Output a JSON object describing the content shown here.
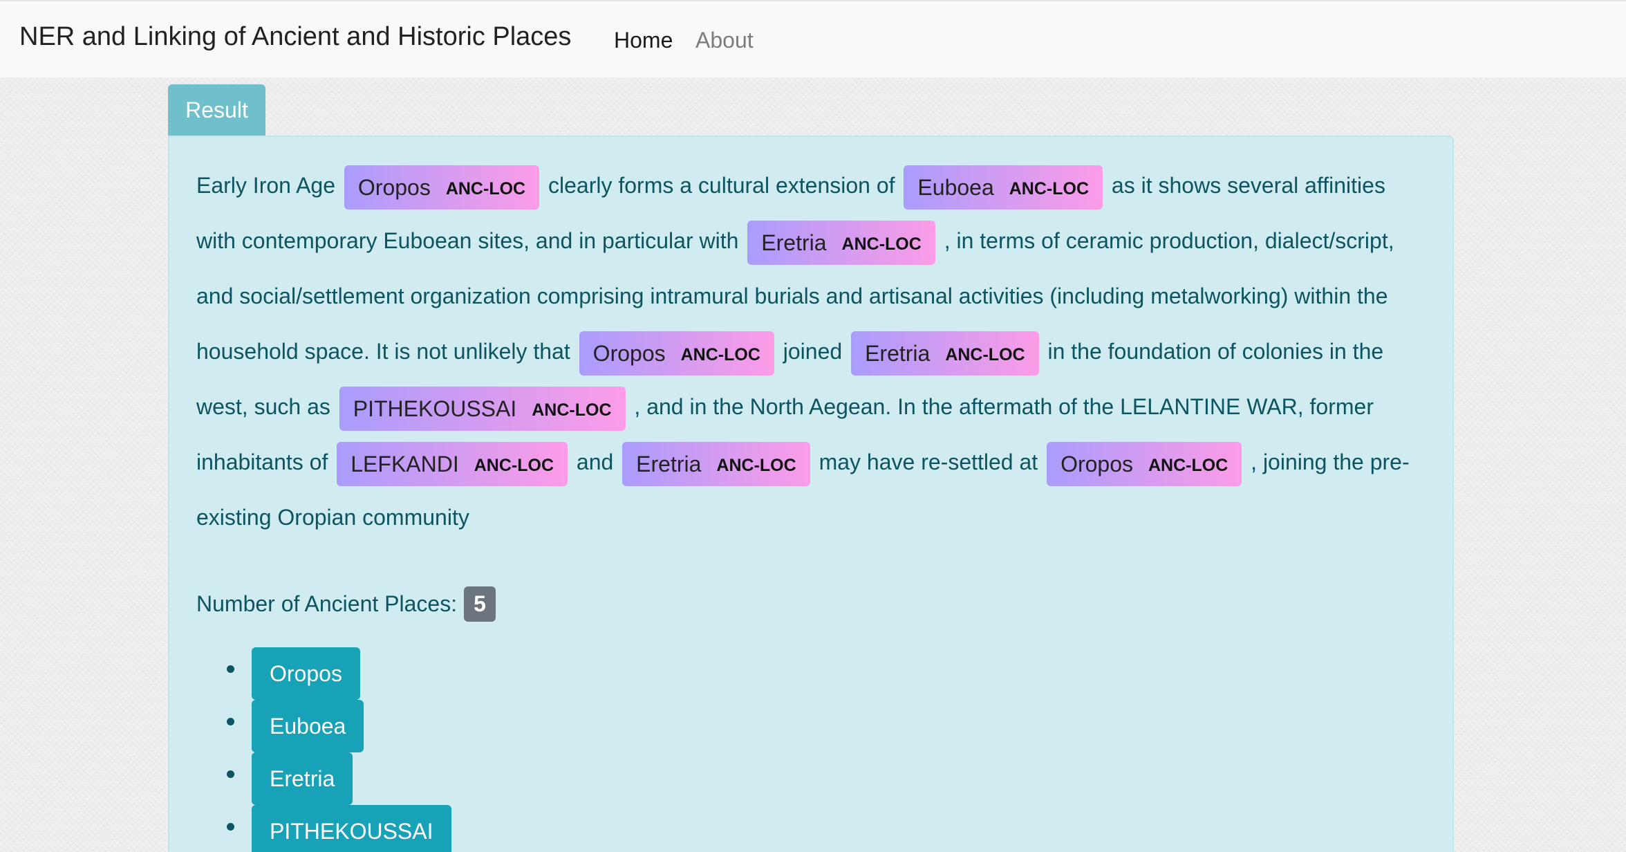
{
  "navbar": {
    "brand": "NER and Linking of Ancient and Historic Places",
    "home": "Home",
    "about": "About"
  },
  "result": {
    "tab_label": "Result",
    "segments": [
      {
        "type": "text",
        "text": "Early Iron Age "
      },
      {
        "type": "entity",
        "text": "Oropos",
        "label": "ANC-LOC"
      },
      {
        "type": "text",
        "text": " clearly forms a cultural extension of "
      },
      {
        "type": "entity",
        "text": "Euboea",
        "label": "ANC-LOC"
      },
      {
        "type": "text",
        "text": " as it shows several affinities with contemporary Euboean sites, and in particular with "
      },
      {
        "type": "entity",
        "text": "Eretria",
        "label": "ANC-LOC"
      },
      {
        "type": "text",
        "text": " , in terms of ceramic production, dialect/script, and social/settlement organization comprising intramural burials and artisanal activities (including metalworking) within the household space. It is not unlikely that "
      },
      {
        "type": "entity",
        "text": "Oropos",
        "label": "ANC-LOC"
      },
      {
        "type": "text",
        "text": " joined "
      },
      {
        "type": "entity",
        "text": "Eretria",
        "label": "ANC-LOC"
      },
      {
        "type": "text",
        "text": " in the foundation of colonies in the west, such as "
      },
      {
        "type": "entity",
        "text": "PITHEKOUSSAI",
        "label": "ANC-LOC"
      },
      {
        "type": "text",
        "text": " , and in the North Aegean. In the aftermath of the LELANTINE WAR, former inhabitants of "
      },
      {
        "type": "entity",
        "text": "LEFKANDI",
        "label": "ANC-LOC"
      },
      {
        "type": "text",
        "text": " and "
      },
      {
        "type": "entity",
        "text": "Eretria",
        "label": "ANC-LOC"
      },
      {
        "type": "text",
        "text": " may have re-settled at "
      },
      {
        "type": "entity",
        "text": "Oropos",
        "label": "ANC-LOC"
      },
      {
        "type": "text",
        "text": " , joining the pre-existing Oropian community"
      }
    ],
    "count_label": "Number of Ancient Places:",
    "count_value": "5",
    "places": [
      "Oropos",
      "Euboea",
      "Eretria",
      "PITHEKOUSSAI"
    ]
  },
  "colors": {
    "panel_bg": "#d1ecf1",
    "panel_text": "#0c5460",
    "entity_gradient_start": "#aa9cfc",
    "entity_gradient_end": "#fc9ce7",
    "place_button": "#17a2b8",
    "badge": "#6c757d",
    "tab": "#6fbfcc"
  }
}
